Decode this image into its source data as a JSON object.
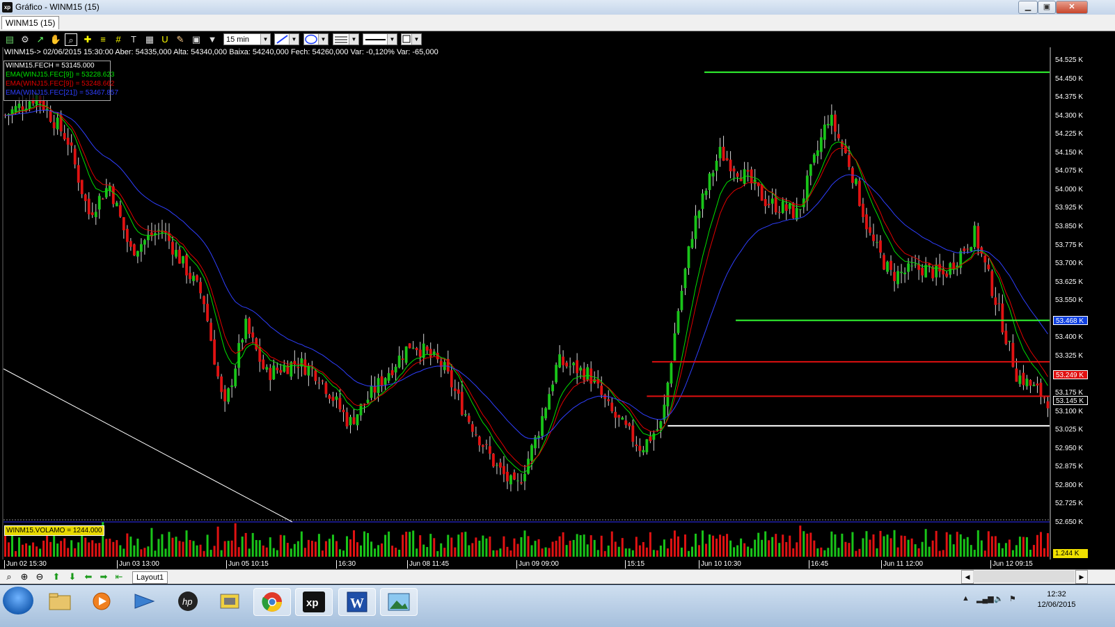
{
  "window": {
    "title": "Gráfico - WINM15 (15)",
    "app_icon": "xp",
    "controls": [
      "minimize-icon",
      "maximize-icon",
      "close-icon"
    ]
  },
  "tabs": [
    {
      "label": "WINM15 (15)"
    }
  ],
  "toolbar": {
    "icons": [
      "chart-icon",
      "settings-gear-icon",
      "tick-icon",
      "hand-pan-icon",
      "zoom-icon",
      "crosshair-icon",
      "horizontal-lines-icon",
      "grid-lines-icon",
      "text-tool-icon",
      "calculator-icon",
      "magnet-icon",
      "eraser-icon",
      "clipboard-icon",
      "filter-icon"
    ],
    "period": "15 min"
  },
  "info_line": "WINM15-> 02/06/2015 15:30:00 Aber: 54335,000 Alta: 54340,000 Baixa: 54240,000 Fech: 54260,000 Var: -0,120% Var: -65,000",
  "legend": [
    {
      "text": "WINM15.FECH = 53145.000",
      "color": "#ffffff"
    },
    {
      "text": "EMA(WINJ15.FEC[9]) = 53228.623",
      "color": "#00e000"
    },
    {
      "text": "EMA(WINJ15.FEC[9]) = 53248.662",
      "color": "#e00000"
    },
    {
      "text": "EMA(WINJ15.FEC[21]) = 53467.857",
      "color": "#2f3fff"
    }
  ],
  "price_axis": {
    "labels": [
      "54.525 K",
      "54.450 K",
      "54.375 K",
      "54.300 K",
      "54.225 K",
      "54.150 K",
      "54.075 K",
      "54.000 K",
      "53.925 K",
      "53.850 K",
      "53.775 K",
      "53.700 K",
      "53.625 K",
      "53.550 K",
      "53.400 K",
      "53.325 K",
      "53.175 K",
      "53.100 K",
      "53.025 K",
      "52.950 K",
      "52.875 K",
      "52.800 K",
      "52.725 K",
      "52.650 K"
    ],
    "markers": [
      {
        "text": "53.468 K",
        "bg": "#1040e0",
        "fg": "#ffffff"
      },
      {
        "text": "53.249 K",
        "bg": "#e01010",
        "fg": "#ffffff"
      },
      {
        "text": "53.145 K",
        "bg": "#000000",
        "fg": "#ffffff"
      }
    ],
    "volume_marker": {
      "text": "1.244 K",
      "bg": "#f0e000",
      "fg": "#000000"
    }
  },
  "volume_legend": "WINM15.VOLAMO = 1244.000",
  "time_axis": [
    "Jun 02 15:30",
    "Jun 03 13:00",
    "Jun 05 10:15",
    "16:30",
    "Jun 08 11:45",
    "Jun 09 09:00",
    "15:15",
    "Jun 10 10:30",
    "16:45",
    "Jun 11 12:00",
    "Jun 12 09:15"
  ],
  "horizontal_lines": [
    {
      "price": 54475,
      "color": "#33ff33"
    },
    {
      "price": 53468,
      "color": "#33ff33"
    },
    {
      "price": 53300,
      "color": "#e01010"
    },
    {
      "price": 53160,
      "color": "#e01010"
    },
    {
      "price": 53040,
      "color": "#ffffff"
    }
  ],
  "chart_data": {
    "type": "candlestick",
    "symbol": "WINM15",
    "period": "15 min",
    "ylim": [
      52650,
      54525
    ],
    "series": [
      {
        "name": "WINM15.FECH",
        "kind": "close",
        "last": 53145.0
      },
      {
        "name": "EMA(WINJ15.FEC[9])",
        "kind": "ema",
        "last": 53228.623
      },
      {
        "name": "EMA(WINJ15.FEC[9])",
        "kind": "ema",
        "last": 53248.662
      },
      {
        "name": "EMA(WINJ15.FEC[21])",
        "kind": "ema",
        "last": 53467.857
      }
    ],
    "close_path": [
      {
        "x": 0,
        "y": 54300
      },
      {
        "x": 0.03,
        "y": 54380
      },
      {
        "x": 0.06,
        "y": 54200
      },
      {
        "x": 0.08,
        "y": 53900
      },
      {
        "x": 0.1,
        "y": 54020
      },
      {
        "x": 0.12,
        "y": 53750
      },
      {
        "x": 0.15,
        "y": 53840
      },
      {
        "x": 0.17,
        "y": 53700
      },
      {
        "x": 0.19,
        "y": 53560
      },
      {
        "x": 0.21,
        "y": 53100
      },
      {
        "x": 0.23,
        "y": 53450
      },
      {
        "x": 0.25,
        "y": 53250
      },
      {
        "x": 0.28,
        "y": 53300
      },
      {
        "x": 0.3,
        "y": 53250
      },
      {
        "x": 0.33,
        "y": 53050
      },
      {
        "x": 0.36,
        "y": 53220
      },
      {
        "x": 0.39,
        "y": 53380
      },
      {
        "x": 0.42,
        "y": 53280
      },
      {
        "x": 0.44,
        "y": 53100
      },
      {
        "x": 0.47,
        "y": 52880
      },
      {
        "x": 0.49,
        "y": 52780
      },
      {
        "x": 0.51,
        "y": 53000
      },
      {
        "x": 0.53,
        "y": 53300
      },
      {
        "x": 0.56,
        "y": 53250
      },
      {
        "x": 0.58,
        "y": 53100
      },
      {
        "x": 0.61,
        "y": 52950
      },
      {
        "x": 0.63,
        "y": 53050
      },
      {
        "x": 0.645,
        "y": 53500
      },
      {
        "x": 0.66,
        "y": 53850
      },
      {
        "x": 0.685,
        "y": 54150
      },
      {
        "x": 0.71,
        "y": 54050
      },
      {
        "x": 0.73,
        "y": 53950
      },
      {
        "x": 0.76,
        "y": 53900
      },
      {
        "x": 0.79,
        "y": 54300
      },
      {
        "x": 0.81,
        "y": 54100
      },
      {
        "x": 0.83,
        "y": 53800
      },
      {
        "x": 0.85,
        "y": 53650
      },
      {
        "x": 0.88,
        "y": 53680
      },
      {
        "x": 0.9,
        "y": 53650
      },
      {
        "x": 0.93,
        "y": 53820
      },
      {
        "x": 0.95,
        "y": 53550
      },
      {
        "x": 0.97,
        "y": 53250
      },
      {
        "x": 1.0,
        "y": 53145
      }
    ]
  },
  "bottom": {
    "layout_tab": "Layout1",
    "nav_icons": [
      "zoom-fit-icon",
      "zoom-in-icon",
      "zoom-out-icon",
      "arrow-up-icon",
      "arrow-down-icon",
      "arrow-left-icon",
      "arrow-right-icon",
      "arrow-end-icon"
    ]
  },
  "taskbar": {
    "apps": [
      "file-explorer-icon",
      "media-player-icon",
      "network-icon",
      "hp-icon",
      "device-icon",
      "chrome-icon",
      "xp-icon",
      "word-icon",
      "picture-icon"
    ],
    "time": "12:32",
    "date": "12/06/2015"
  }
}
